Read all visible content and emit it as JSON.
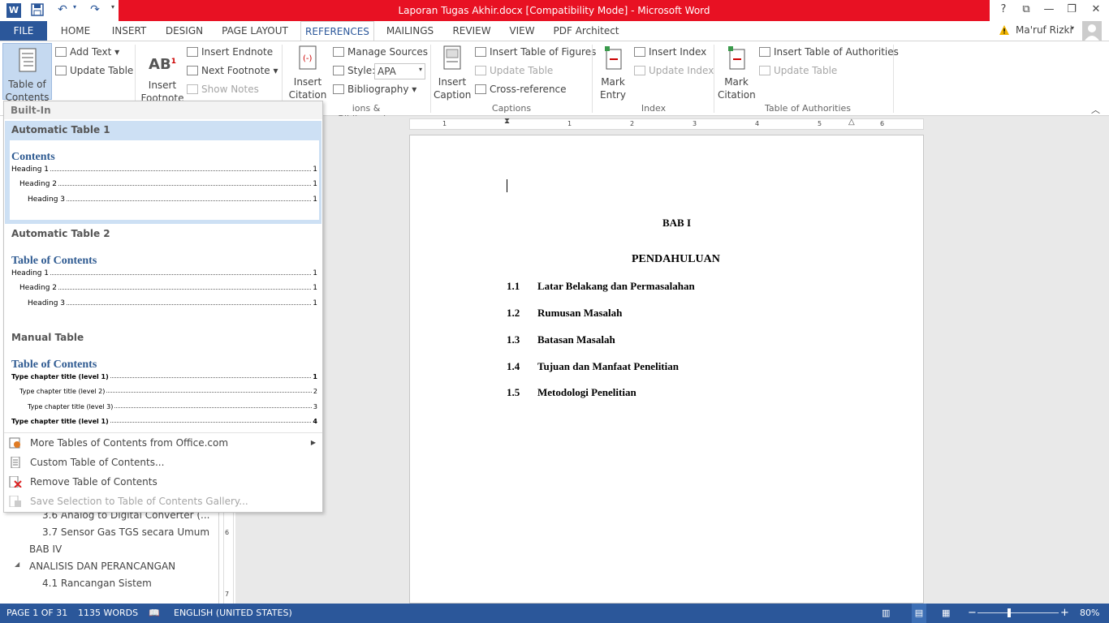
{
  "window": {
    "title": "Laporan Tugas Akhir.docx [Compatibility Mode] -  Microsoft Word",
    "controls": {
      "help": "?",
      "ribbon_opts": "⧉",
      "minimize": "—",
      "restore": "❐",
      "close": "✕"
    }
  },
  "tabs": {
    "file": "FILE",
    "home": "HOME",
    "insert": "INSERT",
    "design": "DESIGN",
    "page_layout": "PAGE LAYOUT",
    "references": "REFERENCES",
    "mailings": "MAILINGS",
    "review": "REVIEW",
    "view": "VIEW",
    "pdf_architect": "PDF Architect"
  },
  "user": {
    "name": "Ma'ruf Rizki"
  },
  "ribbon": {
    "toc": {
      "line1": "Table of",
      "line2": "Contents"
    },
    "add_text": "Add Text",
    "update_table": "Update Table",
    "insert_footnote": {
      "line1": "Insert",
      "line2": "Footnote"
    },
    "insert_endnote": "Insert Endnote",
    "next_footnote": "Next Footnote",
    "show_notes": "Show Notes",
    "insert_citation": {
      "line1": "Insert",
      "line2": "Citation"
    },
    "manage_sources": "Manage Sources",
    "style_label": "Style:",
    "style_value": "APA",
    "bibliography": "Bibliography",
    "citations_group": "ions & Bibliography",
    "insert_caption": {
      "line1": "Insert",
      "line2": "Caption"
    },
    "insert_table_of_figures": "Insert Table of Figures",
    "update_table_fig": "Update Table",
    "cross_reference": "Cross-reference",
    "captions_group": "Captions",
    "mark_entry": {
      "line1": "Mark",
      "line2": "Entry"
    },
    "insert_index": "Insert Index",
    "update_index": "Update Index",
    "index_group": "Index",
    "mark_citation": {
      "line1": "Mark",
      "line2": "Citation"
    },
    "insert_table_of_authorities": "Insert Table of Authorities",
    "update_table_auth": "Update Table",
    "authorities_group": "Table of Authorities"
  },
  "gallery": {
    "builtin": "Built-In",
    "auto1": {
      "name": "Automatic Table 1",
      "title": "Contents",
      "lines": [
        {
          "text": "Heading 1",
          "page": "1"
        },
        {
          "text": "Heading 2",
          "page": "1"
        },
        {
          "text": "Heading 3",
          "page": "1"
        }
      ]
    },
    "auto2": {
      "name": "Automatic Table 2",
      "title": "Table of Contents",
      "lines": [
        {
          "text": "Heading 1",
          "page": "1"
        },
        {
          "text": "Heading 2",
          "page": "1"
        },
        {
          "text": "Heading 3",
          "page": "1"
        }
      ]
    },
    "manual": {
      "name": "Manual Table",
      "title": "Table of Contents",
      "lines": [
        {
          "text": "Type chapter title (level 1)",
          "page": "1"
        },
        {
          "text": "Type chapter title (level 2)",
          "page": "2"
        },
        {
          "text": "Type chapter title (level 3)",
          "page": "3"
        },
        {
          "text": "Type chapter title (level 1)",
          "page": "4"
        }
      ]
    },
    "menu": {
      "more": "More Tables of Contents from Office.com",
      "custom": "Custom Table of Contents...",
      "remove": "Remove Table of Contents",
      "save": "Save Selection to Table of Contents Gallery..."
    }
  },
  "nav": {
    "items": [
      "3.6 Analog to Digital Converter (...",
      "3.7 Sensor Gas TGS secara Umum",
      "BAB IV",
      "ANALISIS DAN PERANCANGAN",
      "4.1 Rancangan Sistem"
    ]
  },
  "ruler": {
    "h": [
      "1",
      "1",
      "2",
      "3",
      "4",
      "5",
      "6"
    ],
    "v": [
      "6",
      "7"
    ]
  },
  "document": {
    "chapter": "BAB I",
    "chapter_title": "PENDAHULUAN",
    "sections": [
      {
        "num": "1.1",
        "title": "Latar Belakang dan Permasalahan"
      },
      {
        "num": "1.2",
        "title": "Rumusan Masalah"
      },
      {
        "num": "1.3",
        "title": "Batasan Masalah"
      },
      {
        "num": "1.4",
        "title": "Tujuan dan Manfaat Penelitian"
      },
      {
        "num": "1.5",
        "title": "Metodologi Penelitian"
      }
    ]
  },
  "status": {
    "page": "PAGE 1 OF 31",
    "words": "1135 WORDS",
    "language": "ENGLISH (UNITED STATES)",
    "zoom": "80%",
    "zoom_minus": "−",
    "zoom_plus": "+"
  },
  "colors": {
    "title_bar": "#e81123",
    "accent": "#2b579a",
    "heading_blue": "#2e5a91"
  }
}
